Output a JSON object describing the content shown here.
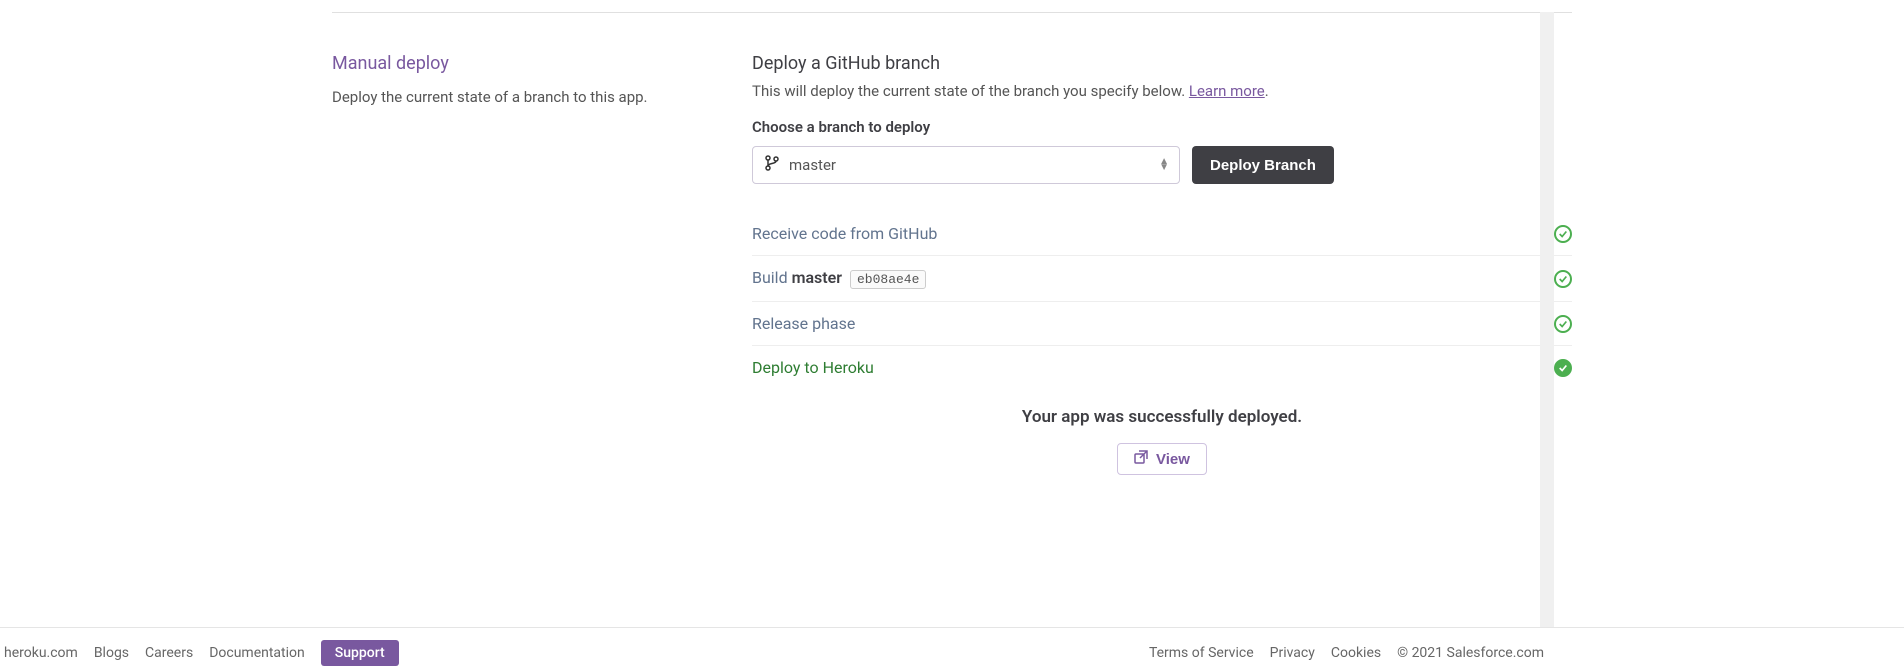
{
  "sidebar": {
    "title": "Manual deploy",
    "desc": "Deploy the current state of a branch to this app."
  },
  "deploy": {
    "heading": "Deploy a GitHub branch",
    "subtext": "This will deploy the current state of the branch you specify below. ",
    "learn_more": "Learn more",
    "choose_label": "Choose a branch to deploy",
    "selected_branch": "master",
    "deploy_button": "Deploy Branch"
  },
  "steps": {
    "receive": "Receive code from GitHub",
    "build_prefix": "Build ",
    "build_branch": "master",
    "build_commit": "eb08ae4e",
    "release": "Release phase",
    "deploy_final": "Deploy to Heroku"
  },
  "success": {
    "message": "Your app was successfully deployed.",
    "view_label": "View"
  },
  "footer": {
    "left": {
      "home": "heroku.com",
      "blogs": "Blogs",
      "careers": "Careers",
      "docs": "Documentation",
      "support": "Support"
    },
    "right": {
      "tos": "Terms of Service",
      "privacy": "Privacy",
      "cookies": "Cookies",
      "copyright": "© 2021 Salesforce.com"
    }
  }
}
